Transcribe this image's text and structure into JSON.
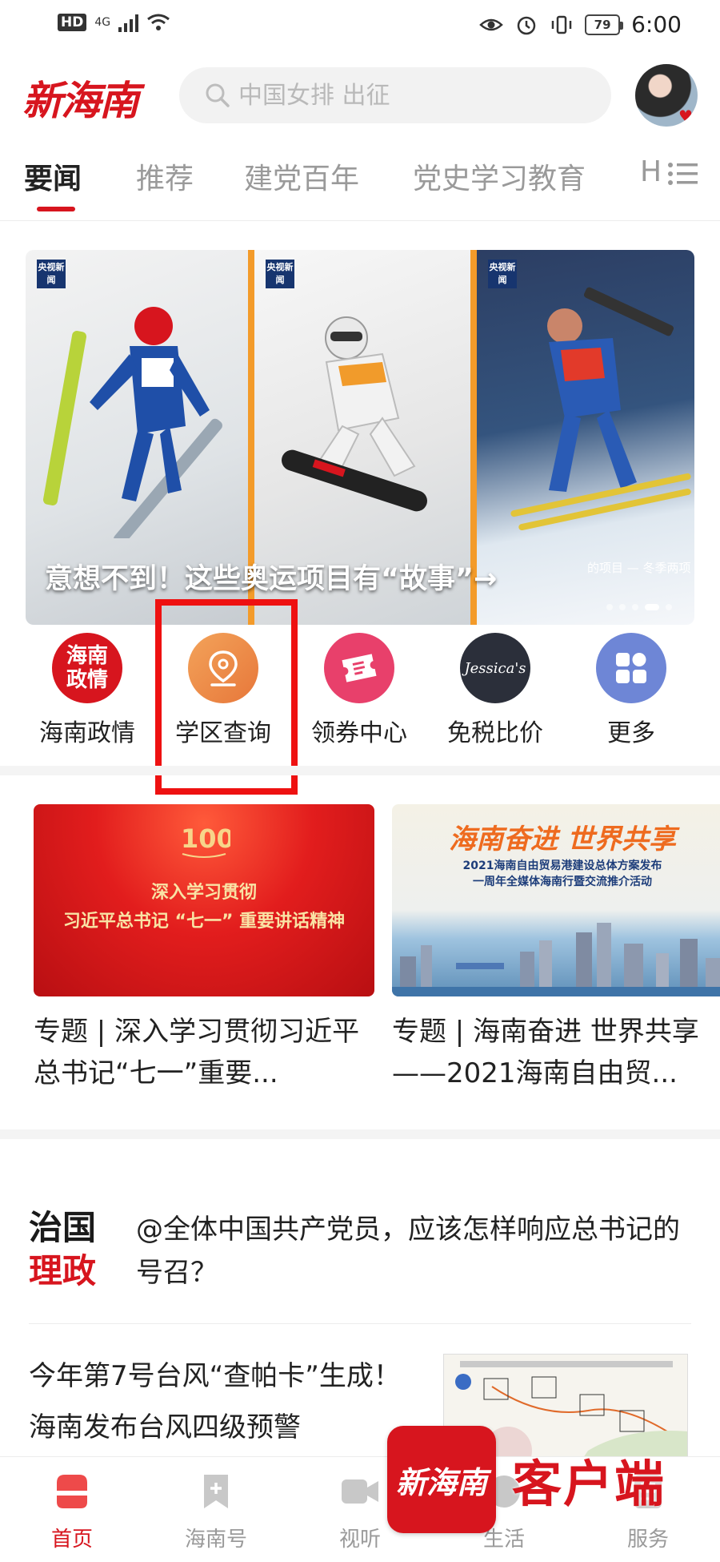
{
  "status_bar": {
    "hd": "HD",
    "network": "4G",
    "battery": "79",
    "time": "6:00"
  },
  "header": {
    "logo": "新海南",
    "search_placeholder": "中国女排 出征"
  },
  "tabs": [
    {
      "label": "要闻"
    },
    {
      "label": "推荐"
    },
    {
      "label": "建党百年"
    },
    {
      "label": "党史学习教育"
    },
    {
      "label": "H"
    }
  ],
  "banner": {
    "title": "意想不到！这些奥运项目有“故事”→",
    "sub_caption": "的项目 — 冬季两项",
    "badge": "央视新闻"
  },
  "shortcuts": [
    {
      "label": "海南政情",
      "icon_text": "海南政情",
      "color": "#d7151e"
    },
    {
      "label": "学区查询",
      "color": "#ee8a45"
    },
    {
      "label": "领券中心",
      "color": "#e8406b"
    },
    {
      "label": "免税比价",
      "icon_text": "Jessica's",
      "color": "#2b2f3a"
    },
    {
      "label": "更多",
      "color": "#6e86d6"
    }
  ],
  "cards": [
    {
      "title": "专题 | 深入学习贯彻习近平总书记“七一”重要...",
      "img_line1": "深入学习贯彻",
      "img_line2": "习近平总书记 “七一” 重要讲话精神"
    },
    {
      "title": "专题 | 海南奋进 世界共享——2021海南自由贸...",
      "img_line1": "海南奋进  世界共享",
      "img_line2": "2021海南自由贸易港建设总体方案发布",
      "img_line3": "一周年全媒体海南行暨交流推介活动"
    }
  ],
  "news": [
    {
      "tag_line1": "治国",
      "tag_line2": "理政",
      "title": "@全体中国共产党员，应该怎样响应总书记的号召？"
    },
    {
      "title": "今年第7号台风“查帕卡”生成！海南发布台风四级预警"
    }
  ],
  "bottom_nav": [
    {
      "label": "首页"
    },
    {
      "label": "海南号"
    },
    {
      "label": "视听"
    },
    {
      "label": "生活"
    },
    {
      "label": "服务"
    }
  ],
  "watermark": {
    "badge": "新海南",
    "text": "客户端"
  },
  "colors": {
    "brand_red": "#d7151e",
    "highlight_red": "#ee1111"
  }
}
